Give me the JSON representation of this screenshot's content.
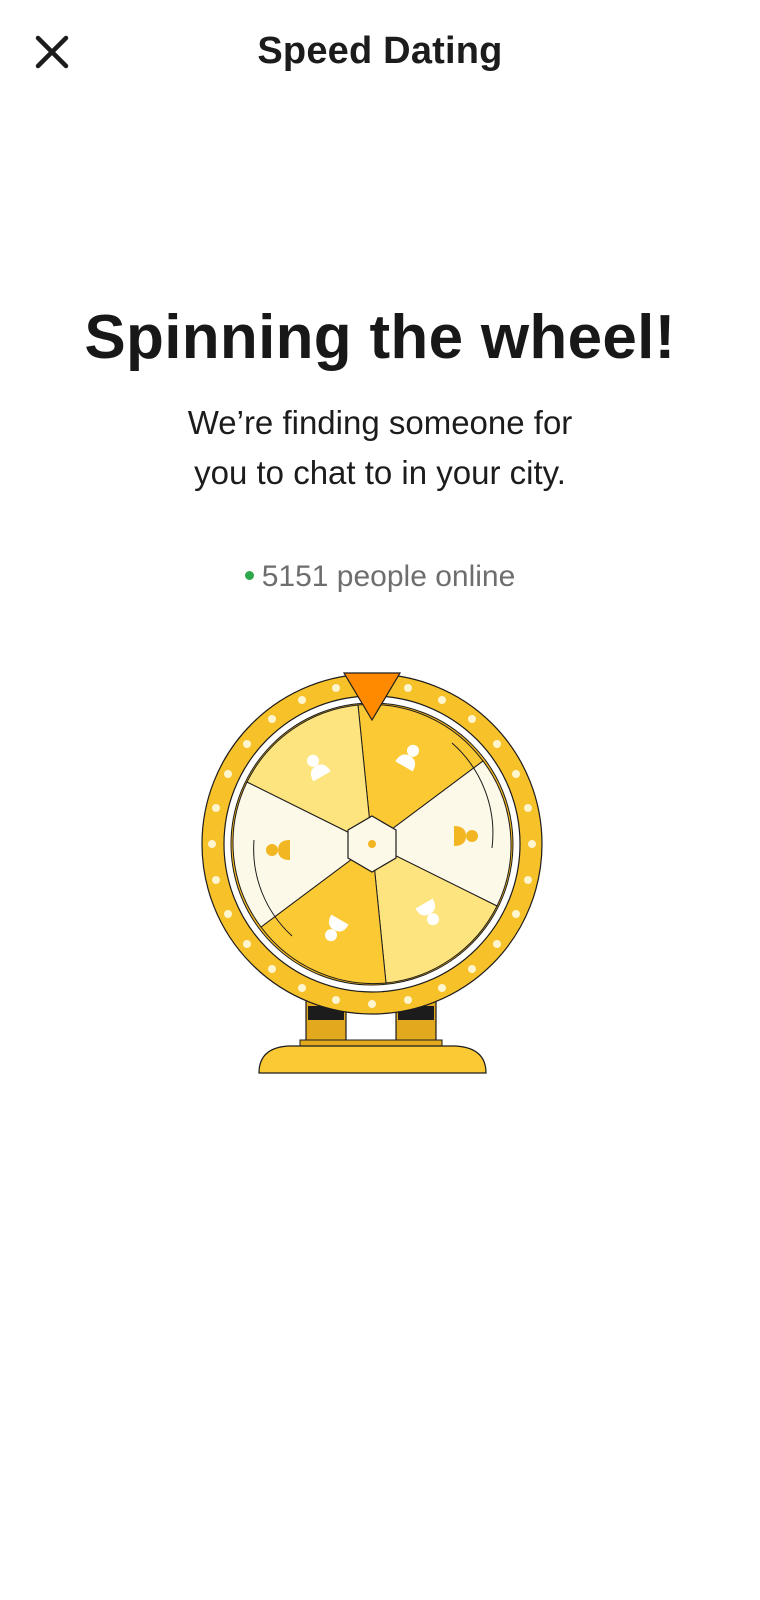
{
  "header": {
    "title": "Speed Dating",
    "close_icon": "close-icon"
  },
  "main": {
    "headline": "Spinning the wheel!",
    "subtitle_line1": "We’re finding someone for",
    "subtitle_line2": "you to chat to in your city.",
    "online_count": "5151",
    "online_suffix": "people online",
    "online_status_color": "#2ea84a"
  },
  "wheel": {
    "illustration": "prize-wheel-illustration",
    "colors": {
      "rim": "#f7c12a",
      "pointer": "#ff8a00",
      "segment_dark": "#fbc934",
      "segment_light": "#fde47e",
      "segment_cream": "#fdf9e8",
      "stand": "#fbc934"
    }
  }
}
